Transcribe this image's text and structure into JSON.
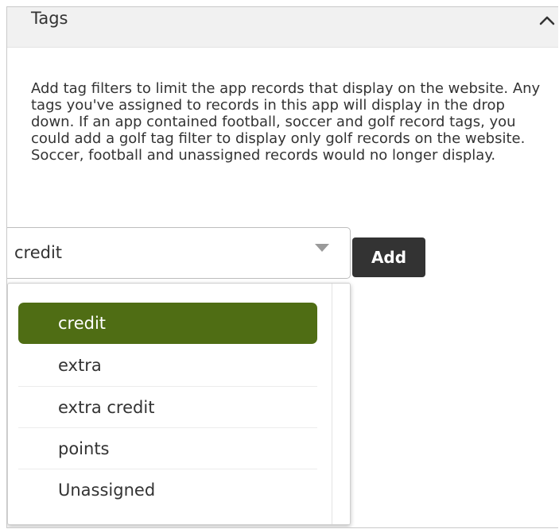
{
  "panel": {
    "title": "Tags",
    "collapse_icon": "chevron-up-icon"
  },
  "description": "Add tag filters to limit the app records that display on the website. Any tags you've assigned to records in this app will display in the drop down. If an app contained football, soccer and golf record tags, you could add a golf tag filter to display only golf records on the website. Soccer, football and unassigned records would no longer display.",
  "tag_select": {
    "value": "credit",
    "arrow_icon": "caret-down-icon"
  },
  "add_button": {
    "label": "Add"
  },
  "dropdown": {
    "options": [
      {
        "label": "credit",
        "selected": true
      },
      {
        "label": "extra",
        "selected": false
      },
      {
        "label": "extra credit",
        "selected": false
      },
      {
        "label": "points",
        "selected": false
      },
      {
        "label": "Unassigned",
        "selected": false
      }
    ]
  },
  "colors": {
    "selected_option_bg": "#4f6d14",
    "add_button_bg": "#333333",
    "header_bg": "#f1f1f1"
  }
}
